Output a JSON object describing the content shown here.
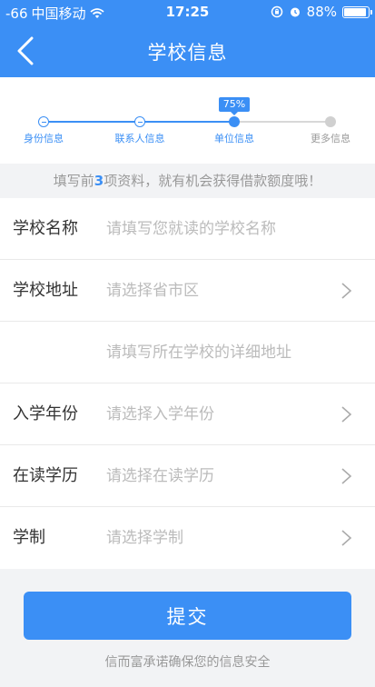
{
  "status_bar": {
    "signal": "-66",
    "carrier": "中国移动",
    "time": "17:25",
    "battery": "88%"
  },
  "nav": {
    "title": "学校信息"
  },
  "progress": {
    "percent_label": "75%",
    "percent": 75,
    "steps": [
      {
        "label": "身份信息",
        "state": "done"
      },
      {
        "label": "联系人信息",
        "state": "done"
      },
      {
        "label": "单位信息",
        "state": "current"
      },
      {
        "label": "更多信息",
        "state": "todo"
      }
    ]
  },
  "tip": {
    "prefix": "填写前",
    "count": "3",
    "suffix": "项资料，就有机会获得借款额度哦！"
  },
  "form": {
    "school_name": {
      "label": "学校名称",
      "placeholder": "请填写您就读的学校名称"
    },
    "school_address": {
      "label": "学校地址",
      "placeholder": "请选择省市区"
    },
    "detail_address": {
      "placeholder": "请填写所在学校的详细地址"
    },
    "enroll_year": {
      "label": "入学年份",
      "placeholder": "请选择入学年份"
    },
    "education": {
      "label": "在读学历",
      "placeholder": "请选择在读学历"
    },
    "school_system": {
      "label": "学制",
      "placeholder": "请选择学制"
    }
  },
  "submit_label": "提交",
  "safety_note": "信而富承诺确保您的信息安全",
  "colors": {
    "primary": "#3b8ff5",
    "background": "#f2f3f5",
    "placeholder": "#bbbbbb"
  }
}
